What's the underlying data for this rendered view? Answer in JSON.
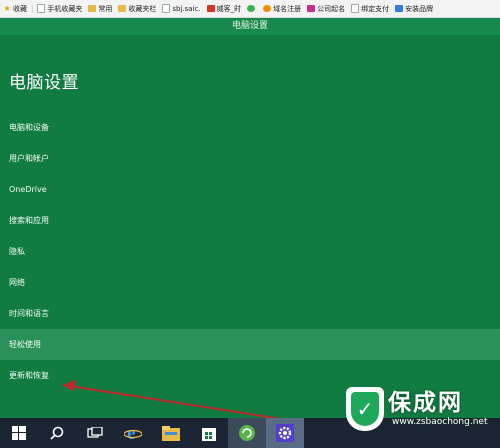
{
  "bookmarks": [
    {
      "icon": "star-icon",
      "label": "收藏"
    },
    {
      "icon": "doc-icon",
      "label": "手机收藏夹"
    },
    {
      "icon": "folder-icon",
      "label": "常用"
    },
    {
      "icon": "folder-icon",
      "label": "收藏夹栏"
    },
    {
      "icon": "doc-icon",
      "label": "sbj.saic."
    },
    {
      "icon": "red-site-icon",
      "label": "威客_时"
    },
    {
      "icon": "green-site-icon",
      "label": ""
    },
    {
      "icon": "orange-site-icon",
      "label": "域名注册"
    },
    {
      "icon": "purple-site-icon",
      "label": "公司起名"
    },
    {
      "icon": "doc-icon",
      "label": "绑定支付"
    },
    {
      "icon": "blue-site-icon",
      "label": "安装品牌"
    }
  ],
  "window": {
    "title": "电脑设置"
  },
  "settings": {
    "page_title": "电脑设置",
    "nav": [
      {
        "label": "电脑和设备"
      },
      {
        "label": "用户和帐户"
      },
      {
        "label": "OneDrive"
      },
      {
        "label": "搜索和应用"
      },
      {
        "label": "隐私"
      },
      {
        "label": "网络"
      },
      {
        "label": "时间和语言"
      },
      {
        "label": "轻松使用"
      },
      {
        "label": "更新和恢复"
      }
    ],
    "highlighted_index": 7
  },
  "taskbar": {
    "items": [
      {
        "icon": "windows-logo-icon"
      },
      {
        "icon": "search-icon"
      },
      {
        "icon": "task-view-icon"
      },
      {
        "icon": "internet-explorer-icon"
      },
      {
        "icon": "file-explorer-icon"
      },
      {
        "icon": "store-icon"
      },
      {
        "icon": "refresh-app-icon"
      },
      {
        "icon": "settings-gear-icon"
      }
    ]
  },
  "watermark": {
    "text": "保成网",
    "subtext": "www.zsbaochong.net"
  },
  "colors": {
    "accent": "#107c41",
    "highlight": "#2a9259",
    "annotation": "#c0282e"
  }
}
